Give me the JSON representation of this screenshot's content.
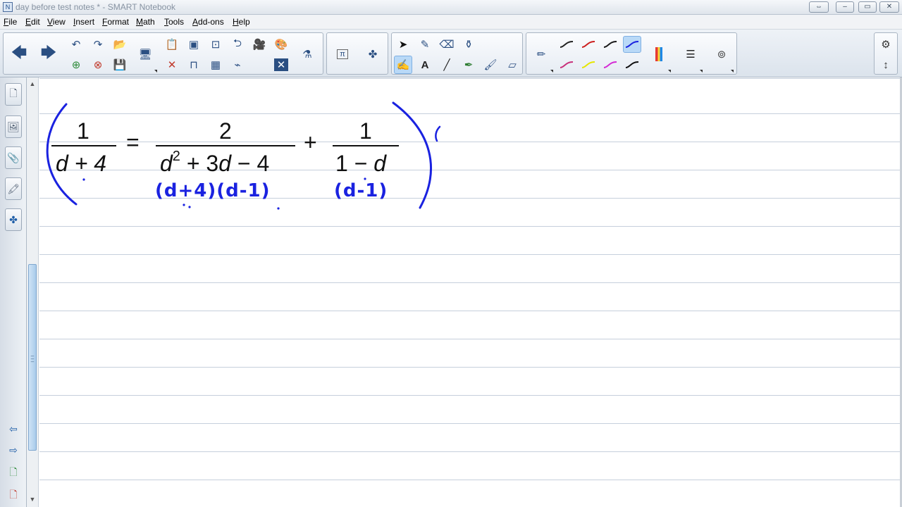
{
  "window": {
    "title": "day before test notes * - SMART Notebook"
  },
  "menu": [
    {
      "label": "File"
    },
    {
      "label": "Edit"
    },
    {
      "label": "View"
    },
    {
      "label": "Insert"
    },
    {
      "label": "Format"
    },
    {
      "label": "Math"
    },
    {
      "label": "Tools"
    },
    {
      "label": "Add-ons"
    },
    {
      "label": "Help"
    }
  ],
  "toolbar": {
    "nav": [
      "left-arrow-icon",
      "right-arrow-icon"
    ],
    "edit": [
      "undo-icon",
      "redo-icon",
      "open-icon",
      "add-page-icon",
      "delete-page-icon",
      "save-icon"
    ],
    "pen_colors": [
      "#222222",
      "#cc1f1f",
      "#1a1a1a",
      "#1a22e0",
      "#c8307a",
      "#e6e600",
      "#d42ad4",
      "#111111"
    ],
    "selected_pen_color": "#1a22e0"
  },
  "equation": {
    "left_paren": "(",
    "right_paren": ")",
    "lhs_num": "1",
    "lhs_den": "d + 4",
    "equals": "=",
    "r1_num": "2",
    "r1_den_a": "d",
    "r1_den_exp": "2",
    "r1_den_b": " + 3",
    "r1_den_c": "d",
    "r1_den_d": " − 4",
    "plus": "+",
    "r2_num": "1",
    "r2_den_a": "1 − ",
    "r2_den_b": "d"
  },
  "annotations": {
    "factor_1": "(d+4)(d-1)",
    "factor_2": "(d-1)",
    "stray_mark": "("
  },
  "ink_color": "#1a22e0"
}
